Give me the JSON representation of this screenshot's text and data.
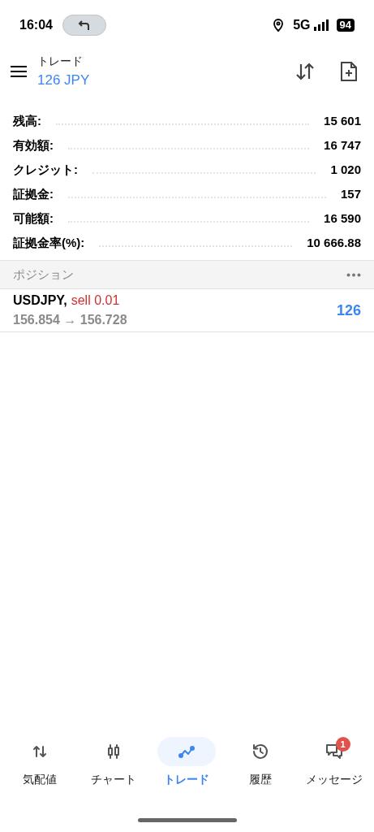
{
  "status_bar": {
    "time": "16:04",
    "network": "5G",
    "battery": "94"
  },
  "header": {
    "title": "トレード",
    "profit": "126 JPY"
  },
  "account": [
    {
      "label": "残高:",
      "value": "15 601"
    },
    {
      "label": "有効額:",
      "value": "16 747"
    },
    {
      "label": "クレジット:",
      "value": "1 020"
    },
    {
      "label": "証拠金:",
      "value": "157"
    },
    {
      "label": "可能額:",
      "value": "16 590"
    },
    {
      "label": "証拠金率(%):",
      "value": "10 666.88"
    }
  ],
  "positions": {
    "title": "ポジション",
    "items": [
      {
        "symbol": "USDJPY,",
        "type": "sell",
        "volume": "0.01",
        "prices": "156.854 → 156.728",
        "profit": "126"
      }
    ]
  },
  "nav": [
    {
      "kind": "quotes",
      "label": "気配値",
      "selected": false
    },
    {
      "kind": "chart",
      "label": "チャート",
      "selected": false
    },
    {
      "kind": "trade",
      "label": "トレード",
      "selected": true
    },
    {
      "kind": "history",
      "label": "履歴",
      "selected": false
    },
    {
      "kind": "messages",
      "label": "メッセージ",
      "selected": false,
      "badge": "1"
    }
  ]
}
